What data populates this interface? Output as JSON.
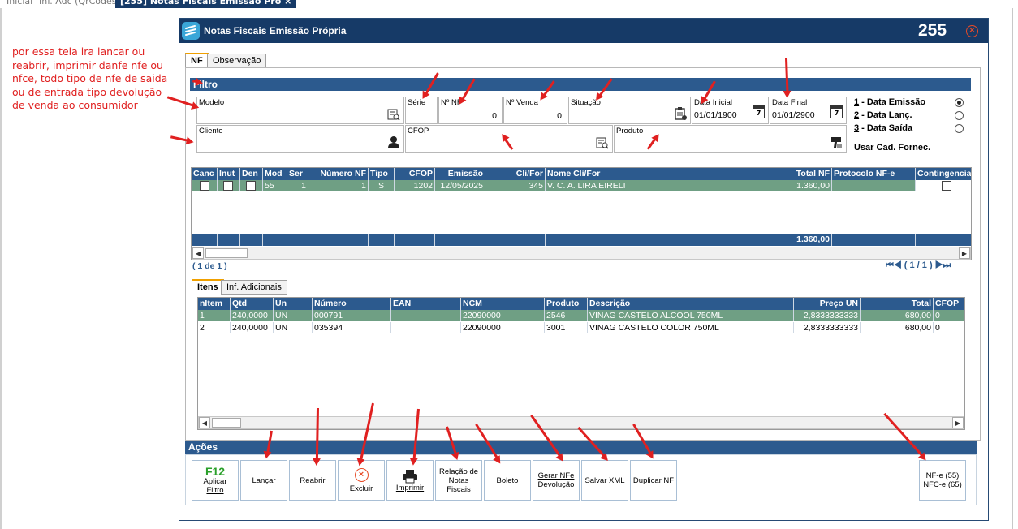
{
  "top_tabs": [
    "Inicial",
    "Inf. Adc (QrCodes)",
    "[255] Notas Fiscais Emissão Pró"
  ],
  "top_tab_close": "×",
  "note": "por essa tela ira lancar ou reabrir, imprimir danfe nfe ou nfce, todo tipo de nfe de saida ou de entrada tipo devolução de venda ao consumidor",
  "window": {
    "title": "Notas Fiscais Emissão Própria",
    "number": "255",
    "close": "⊗"
  },
  "tabs": {
    "nf": "NF",
    "observacao": "Observação"
  },
  "filtro": {
    "title": "Filtro",
    "modelo": "Modelo",
    "serie": "Série",
    "num_nf": {
      "label": "Nº NF",
      "value": "0"
    },
    "num_venda": {
      "label": "Nº Venda",
      "value": "0"
    },
    "situacao": "Situação",
    "data_inicial": {
      "label": "Data Inicial",
      "value": "01/01/1900"
    },
    "data_final": {
      "label": "Data Final",
      "value": "01/01/2900"
    },
    "cliente": "Cliente",
    "cfop": "CFOP",
    "produto": "Produto",
    "calendar_day": "7",
    "radios": [
      {
        "key": "1",
        "label": " - Data Emissão",
        "selected": true
      },
      {
        "key": "2",
        "label": " - Data Lanç.",
        "selected": false
      },
      {
        "key": "3",
        "label": " - Data Saída",
        "selected": false
      }
    ],
    "usar_cad_fornec": "Usar Cad. Fornec."
  },
  "nf_grid": {
    "headers": [
      "Canc",
      "Inut",
      "Den",
      "Mod",
      "Ser",
      "Número NF",
      "Tipo",
      "CFOP",
      "Emissão",
      "Cli/For",
      "Nome Cli/For",
      "Total NF",
      "Protocolo NF-e",
      "Contingencia"
    ],
    "rows": [
      {
        "mod": "55",
        "ser": "1",
        "numero": "1",
        "tipo": "S",
        "cfop": "1202",
        "emissao": "12/05/2025",
        "clifor": "345",
        "nome": "V. C. A. LIRA EIRELI",
        "total": "1.360,00",
        "protocolo": ""
      }
    ],
    "footer_total": "1.360,00",
    "record_count": "( 1 de 1 )",
    "pager": "( 1 / 1 )"
  },
  "items_tabs": {
    "itens": "Itens",
    "inf_adicionais": "Inf. Adicionais"
  },
  "items_grid": {
    "headers": [
      "nItem",
      "Qtd",
      "Un",
      "Número",
      "EAN",
      "NCM",
      "Produto",
      "Descrição",
      "Preço UN",
      "Total",
      "CFOP"
    ],
    "rows": [
      {
        "nitem": "1",
        "qtd": "240,0000",
        "un": "UN",
        "numero": "000791",
        "ean": "",
        "ncm": "22090000",
        "produto": "2546",
        "descricao": "VINAG CASTELO ALCOOL 750ML",
        "preco": "2,8333333333",
        "total": "680,00",
        "cfop": "0"
      },
      {
        "nitem": "2",
        "qtd": "240,0000",
        "un": "UN",
        "numero": "035394",
        "ean": "",
        "ncm": "22090000",
        "produto": "3001",
        "descricao": "VINAG CASTELO COLOR 750ML",
        "preco": "2,8333333333",
        "total": "680,00",
        "cfop": "0"
      }
    ]
  },
  "acoes": {
    "title": "Ações",
    "aplicar_icon": "F12",
    "aplicar": [
      "Aplicar",
      "Filtro"
    ],
    "lancar": "Lançar",
    "reabrir": "Reabrir",
    "excluir": "Excluir",
    "excluir_icon": "×",
    "imprimir": "Imprimir",
    "relacao": [
      "Relação de",
      "Notas",
      "Fiscais"
    ],
    "boleto": "Boleto",
    "gerar": [
      "Gerar NFe",
      "Devolução"
    ],
    "salvar_xml": "Salvar XML",
    "duplicar": "Duplicar NF",
    "nfe": [
      "NF-e (55)",
      "NFC-e (65)"
    ]
  },
  "colors": {
    "navy": "#163a67",
    "header_blue": "#2c5a8e",
    "selected_row": "#6f9f84",
    "annotation_red": "#e02020",
    "accent_orange": "#e84b27"
  }
}
